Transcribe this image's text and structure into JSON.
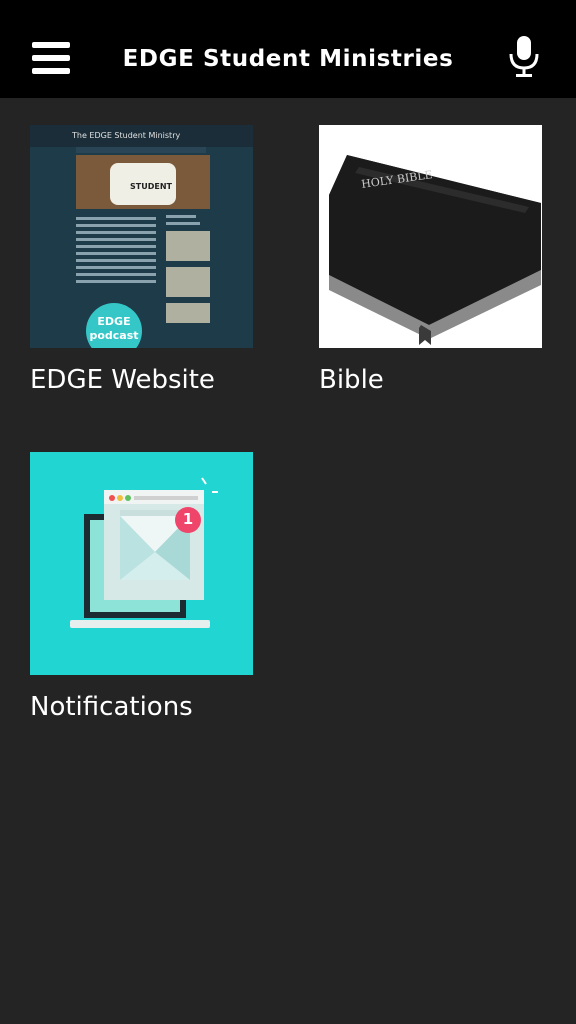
{
  "header": {
    "title": "EDGE Student Ministries",
    "menu_icon": "hamburger-menu-icon",
    "mic_icon": "microphone-icon"
  },
  "tiles": [
    {
      "label": "EDGE Website",
      "thumb": {
        "site_title": "The EDGE Student Ministry",
        "logo_text": "STUDENT",
        "podcast_text": "EDGE podcast"
      }
    },
    {
      "label": "Bible",
      "thumb": {
        "cover_text": "HOLY BIBLE"
      }
    },
    {
      "label": "Notifications",
      "thumb": {
        "badge": "1"
      }
    }
  ],
  "colors": {
    "background": "#242424",
    "topbar": "#000000",
    "notification_bg": "#21d6d2",
    "badge": "#f0456a"
  }
}
